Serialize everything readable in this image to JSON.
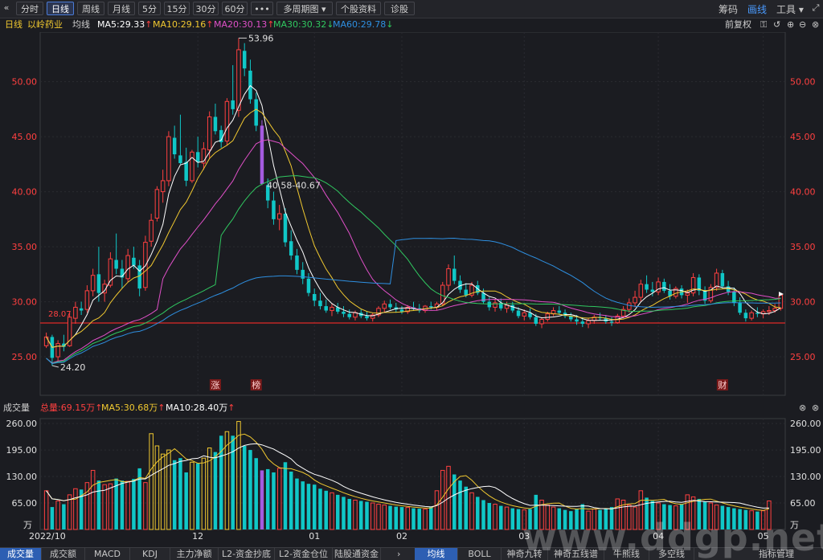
{
  "toolbar": {
    "collapse_icon": "double-chevron-left-icon",
    "buttons": [
      "分时",
      "日线",
      "周线",
      "月线",
      "5分",
      "15分",
      "30分",
      "60分",
      "•••",
      "多周期图",
      "个股资料",
      "诊股"
    ],
    "active_index": 1,
    "right": [
      "筹码",
      "画线",
      "工具"
    ]
  },
  "indicator_line": {
    "period": "日线",
    "stock_name": "以岭药业",
    "avg_label": "均线",
    "ma5": "MA5:29.33",
    "ma10": "MA10:29.16",
    "ma20": "MA20:30.13",
    "ma30": "MA30:30.32",
    "ma60": "MA60:29.78",
    "adjust": "前复权",
    "arrows": [
      "↑",
      "↑",
      "↑",
      "↓",
      "↓"
    ]
  },
  "colors": {
    "up": "#ff4040",
    "down": "#10c7c7",
    "highlight": "#a45be0",
    "ma5": "#ffffff",
    "ma10": "#f0c830",
    "ma20": "#e050c8",
    "ma30": "#30c860",
    "ma60": "#2e8fe0",
    "hline": "#e02828",
    "axis_red": "#ff4040"
  },
  "chart_data": {
    "type": "candlestick",
    "y_ticks": [
      "50.00",
      "45.00",
      "40.00",
      "35.00",
      "30.00",
      "25.00"
    ],
    "y_tick_values": [
      50,
      45,
      40,
      35,
      30,
      25
    ],
    "ylim": [
      21.5,
      54.5
    ],
    "x_labels": [
      "2022/10",
      "12",
      "01",
      "02",
      "03",
      "04",
      "05"
    ],
    "x_label_index": [
      0,
      26,
      46,
      61,
      82,
      105,
      123
    ],
    "annotations": {
      "high": "53.96",
      "low": "24.20",
      "gap": "40.58-40.67",
      "support": "28.07"
    },
    "markers": [
      "涨",
      "榜",
      "财"
    ],
    "marker_index": [
      29,
      36,
      116
    ],
    "support_value": 28.07,
    "highlight_index": 37,
    "ohlc": [
      [
        26.0,
        27.2,
        25.8,
        26.8
      ],
      [
        26.8,
        27.0,
        24.2,
        24.9
      ],
      [
        25.0,
        26.5,
        24.6,
        26.2
      ],
      [
        26.2,
        27.0,
        25.5,
        25.9
      ],
      [
        26.0,
        29.0,
        25.9,
        28.6
      ],
      [
        28.5,
        30.0,
        28.0,
        29.5
      ],
      [
        29.4,
        30.0,
        28.8,
        29.2
      ],
      [
        29.3,
        31.5,
        29.0,
        31.0
      ],
      [
        31.0,
        33.0,
        30.5,
        32.4
      ],
      [
        32.5,
        35.0,
        30.0,
        30.8
      ],
      [
        30.8,
        32.0,
        30.0,
        31.6
      ],
      [
        31.5,
        34.5,
        31.3,
        33.9
      ],
      [
        33.8,
        36.2,
        32.5,
        33.0
      ],
      [
        33.0,
        33.8,
        31.2,
        32.2
      ],
      [
        32.1,
        34.8,
        31.8,
        34.2
      ],
      [
        34.0,
        35.0,
        33.0,
        33.3
      ],
      [
        33.3,
        33.8,
        30.5,
        31.2
      ],
      [
        31.3,
        36.0,
        31.0,
        35.4
      ],
      [
        35.5,
        38.0,
        35.0,
        37.4
      ],
      [
        37.6,
        40.5,
        37.3,
        40.2
      ],
      [
        40.0,
        42.0,
        39.0,
        41.0
      ],
      [
        41.0,
        45.5,
        40.5,
        45.0
      ],
      [
        44.9,
        46.0,
        43.0,
        43.4
      ],
      [
        43.3,
        47.0,
        42.5,
        42.6
      ],
      [
        42.7,
        44.0,
        40.5,
        41.0
      ],
      [
        41.0,
        43.8,
        40.8,
        43.6
      ],
      [
        43.6,
        45.0,
        42.2,
        42.7
      ],
      [
        42.6,
        44.5,
        42.0,
        43.9
      ],
      [
        43.8,
        47.3,
        43.0,
        46.8
      ],
      [
        46.8,
        48.0,
        45.2,
        45.5
      ],
      [
        45.6,
        46.0,
        44.0,
        44.5
      ],
      [
        44.6,
        48.5,
        44.2,
        48.2
      ],
      [
        48.3,
        51.5,
        47.0,
        47.5
      ],
      [
        47.4,
        53.96,
        46.8,
        52.9
      ],
      [
        52.8,
        53.5,
        50.5,
        51.2
      ],
      [
        51.0,
        52.0,
        48.0,
        48.4
      ],
      [
        48.4,
        49.0,
        45.5,
        46.0
      ],
      [
        46.0,
        46.5,
        40.6,
        40.7
      ],
      [
        40.6,
        41.2,
        38.5,
        39.2
      ],
      [
        39.2,
        40.0,
        37.0,
        37.5
      ],
      [
        37.5,
        38.8,
        36.5,
        38.0
      ],
      [
        38.0,
        38.5,
        35.0,
        35.4
      ],
      [
        35.5,
        36.5,
        33.8,
        34.2
      ],
      [
        34.2,
        34.8,
        32.5,
        32.9
      ],
      [
        32.9,
        33.6,
        31.6,
        32.1
      ],
      [
        32.1,
        32.6,
        30.5,
        30.8
      ],
      [
        30.7,
        31.2,
        29.6,
        30.1
      ],
      [
        30.1,
        30.8,
        29.3,
        29.6
      ],
      [
        29.6,
        30.2,
        29.0,
        29.2
      ],
      [
        29.2,
        29.8,
        28.7,
        29.5
      ],
      [
        29.5,
        29.9,
        28.9,
        29.1
      ],
      [
        29.1,
        29.6,
        28.6,
        28.9
      ],
      [
        28.9,
        29.3,
        28.4,
        28.6
      ],
      [
        28.6,
        29.2,
        28.3,
        29.0
      ],
      [
        29.0,
        29.3,
        28.5,
        28.7
      ],
      [
        28.7,
        29.1,
        28.3,
        28.5
      ],
      [
        28.5,
        29.0,
        28.2,
        28.8
      ],
      [
        28.8,
        29.6,
        28.6,
        29.4
      ],
      [
        29.4,
        30.1,
        29.0,
        29.8
      ],
      [
        29.8,
        30.2,
        29.3,
        29.5
      ],
      [
        29.5,
        29.9,
        29.0,
        29.3
      ],
      [
        29.3,
        29.6,
        28.9,
        29.1
      ],
      [
        29.1,
        29.7,
        28.9,
        29.5
      ],
      [
        29.5,
        30.0,
        29.2,
        29.4
      ],
      [
        29.4,
        29.8,
        29.0,
        29.2
      ],
      [
        29.2,
        29.7,
        29.0,
        29.6
      ],
      [
        29.6,
        30.0,
        29.3,
        29.5
      ],
      [
        29.5,
        30.0,
        29.2,
        29.8
      ],
      [
        29.8,
        31.8,
        29.6,
        31.5
      ],
      [
        31.5,
        33.4,
        31.0,
        33.0
      ],
      [
        33.0,
        34.2,
        31.6,
        31.9
      ],
      [
        31.9,
        32.4,
        30.8,
        31.1
      ],
      [
        31.1,
        31.7,
        30.4,
        30.6
      ],
      [
        30.6,
        31.8,
        30.4,
        31.5
      ],
      [
        31.5,
        31.9,
        30.6,
        30.8
      ],
      [
        30.8,
        31.2,
        29.8,
        30.0
      ],
      [
        30.0,
        30.4,
        29.2,
        29.5
      ],
      [
        29.5,
        30.2,
        29.1,
        29.9
      ],
      [
        29.9,
        30.3,
        29.2,
        29.4
      ],
      [
        29.4,
        30.0,
        29.0,
        29.7
      ],
      [
        29.7,
        30.0,
        29.0,
        29.2
      ],
      [
        29.2,
        29.5,
        28.5,
        28.7
      ],
      [
        28.7,
        29.3,
        28.3,
        29.0
      ],
      [
        29.0,
        29.4,
        28.4,
        28.6
      ],
      [
        28.6,
        28.9,
        27.8,
        28.0
      ],
      [
        28.0,
        28.6,
        27.6,
        28.4
      ],
      [
        28.4,
        29.1,
        28.2,
        28.9
      ],
      [
        28.9,
        29.5,
        28.7,
        29.2
      ],
      [
        29.2,
        29.6,
        28.8,
        29.0
      ],
      [
        29.0,
        29.3,
        28.5,
        28.7
      ],
      [
        28.7,
        29.0,
        28.2,
        28.4
      ],
      [
        28.4,
        28.8,
        27.9,
        28.2
      ],
      [
        28.2,
        28.6,
        27.7,
        28.0
      ],
      [
        28.0,
        28.5,
        27.6,
        28.3
      ],
      [
        28.3,
        28.8,
        28.0,
        28.6
      ],
      [
        28.6,
        29.0,
        28.3,
        28.5
      ],
      [
        28.5,
        28.8,
        28.0,
        28.2
      ],
      [
        28.2,
        28.6,
        27.8,
        28.1
      ],
      [
        28.1,
        28.9,
        28.0,
        28.7
      ],
      [
        28.7,
        29.6,
        28.5,
        29.3
      ],
      [
        29.3,
        30.3,
        29.0,
        29.9
      ],
      [
        29.9,
        31.0,
        29.5,
        30.4
      ],
      [
        30.4,
        32.0,
        30.0,
        31.6
      ],
      [
        31.6,
        32.4,
        30.8,
        31.1
      ],
      [
        31.1,
        31.8,
        30.5,
        30.9
      ],
      [
        30.9,
        32.2,
        30.6,
        31.8
      ],
      [
        31.8,
        32.1,
        30.8,
        31.0
      ],
      [
        31.0,
        31.6,
        30.2,
        30.5
      ],
      [
        30.5,
        31.4,
        30.3,
        31.2
      ],
      [
        31.2,
        31.5,
        30.3,
        30.6
      ],
      [
        30.6,
        31.1,
        29.9,
        30.8
      ],
      [
        30.8,
        32.6,
        30.5,
        32.2
      ],
      [
        32.2,
        32.5,
        30.6,
        31.0
      ],
      [
        31.0,
        31.4,
        29.8,
        30.1
      ],
      [
        30.1,
        31.6,
        29.9,
        31.3
      ],
      [
        31.3,
        33.0,
        31.0,
        32.6
      ],
      [
        32.6,
        32.9,
        31.2,
        31.4
      ],
      [
        31.4,
        31.9,
        30.6,
        30.9
      ],
      [
        30.9,
        31.3,
        29.6,
        29.9
      ],
      [
        29.9,
        30.4,
        28.8,
        29.0
      ],
      [
        29.0,
        29.3,
        28.2,
        28.5
      ],
      [
        28.5,
        29.2,
        28.3,
        29.0
      ],
      [
        29.0,
        29.5,
        28.6,
        28.9
      ],
      [
        28.9,
        29.3,
        28.5,
        29.1
      ],
      [
        29.1,
        29.6,
        28.8,
        29.2
      ],
      [
        29.2,
        29.8,
        29.0,
        29.4
      ],
      [
        29.4,
        30.7,
        29.2,
        30.6
      ]
    ],
    "ma_periods": [
      5,
      10,
      20,
      30,
      60
    ]
  },
  "volume": {
    "title": "成交量",
    "total": "总量:69.15万",
    "ma5": "MA5:30.68万",
    "ma10": "MA10:28.40万",
    "y_ticks": [
      "260.00",
      "195.00",
      "130.00",
      "65.00"
    ],
    "y_tick_values": [
      260,
      195,
      130,
      65
    ],
    "unit": "万",
    "ylim": [
      0,
      272
    ],
    "values": [
      95,
      55,
      70,
      62,
      85,
      100,
      98,
      115,
      145,
      120,
      110,
      112,
      125,
      120,
      118,
      124,
      150,
      115,
      235,
      205,
      185,
      195,
      170,
      175,
      140,
      165,
      162,
      175,
      200,
      190,
      230,
      240,
      230,
      265,
      205,
      195,
      175,
      145,
      148,
      140,
      150,
      165,
      142,
      125,
      118,
      112,
      110,
      100,
      95,
      90,
      85,
      80,
      75,
      72,
      70,
      68,
      65,
      62,
      60,
      58,
      56,
      55,
      54,
      52,
      51,
      50,
      55,
      95,
      145,
      155,
      135,
      120,
      105,
      90,
      80,
      72,
      65,
      62,
      58,
      55,
      52,
      50,
      48,
      50,
      85,
      72,
      60,
      55,
      52,
      48,
      45,
      50,
      62,
      45,
      50,
      48,
      52,
      55,
      75,
      72,
      60,
      55,
      95,
      78,
      70,
      65,
      62,
      60,
      58,
      62,
      85,
      80,
      75,
      68,
      65,
      60,
      58,
      55,
      52,
      50,
      48,
      46,
      44,
      46,
      70
    ]
  },
  "bottom_tabs": [
    "成交量",
    "成交额",
    "MACD",
    "KDJ",
    "主力净额",
    "L2-资金抄底",
    "L2-资金仓位",
    "陆股通资金"
  ],
  "bottom_tabs_right": [
    "均线",
    "BOLL",
    "神奇九转",
    "神奇五线谱",
    "牛熊线",
    "多空线"
  ],
  "bottom_right_label": "指标管理",
  "watermark": "www.ddgp.net"
}
